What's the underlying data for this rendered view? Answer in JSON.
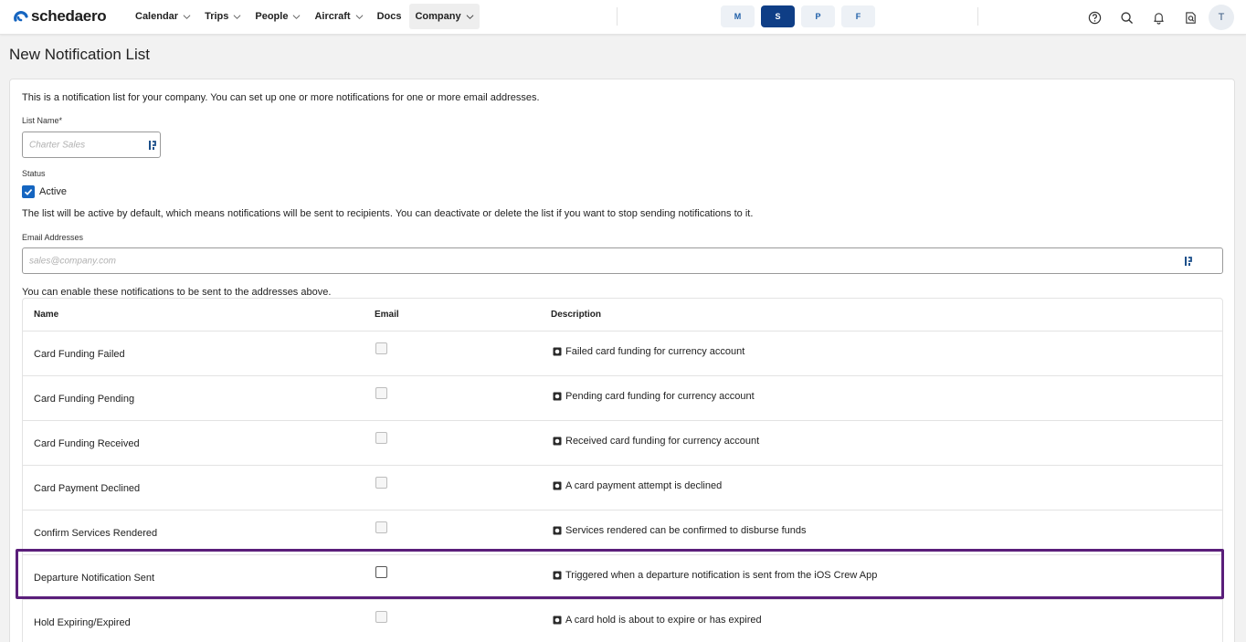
{
  "brand": {
    "name": "schedaero"
  },
  "nav": [
    {
      "label": "Calendar",
      "has_menu": true
    },
    {
      "label": "Trips",
      "has_menu": true
    },
    {
      "label": "People",
      "has_menu": true
    },
    {
      "label": "Aircraft",
      "has_menu": true
    },
    {
      "label": "Docs",
      "has_menu": false
    },
    {
      "label": "Company",
      "has_menu": true,
      "active": true
    }
  ],
  "modes": [
    {
      "label": "M",
      "selected": false
    },
    {
      "label": "S",
      "selected": true
    },
    {
      "label": "P",
      "selected": false
    },
    {
      "label": "F",
      "selected": false
    }
  ],
  "top_icons": [
    "help-icon",
    "search-icon",
    "bell-icon",
    "document-search-icon"
  ],
  "user": {
    "initial": "T"
  },
  "page": {
    "title": "New Notification List"
  },
  "form": {
    "intro": "This is a notification list for your company. You can set up one or more notifications for one or more email addresses.",
    "list_name_label": "List Name*",
    "list_name_placeholder": "Charter Sales",
    "status_label": "Status",
    "active_label": "Active",
    "active_checked": true,
    "status_note": "The list will be active by default, which means notifications will be sent to recipients. You can deactivate or delete the list if you want to stop sending notifications to it.",
    "email_label": "Email Addresses",
    "email_placeholder": "sales@company.com",
    "enable_note": "You can enable these notifications to be sent to the addresses above."
  },
  "table": {
    "columns": {
      "name": "Name",
      "email": "Email",
      "description": "Description"
    },
    "rows": [
      {
        "name": "Card Funding Failed",
        "email": false,
        "description": "Failed card funding for currency account"
      },
      {
        "name": "Card Funding Pending",
        "email": false,
        "description": "Pending card funding for currency account"
      },
      {
        "name": "Card Funding Received",
        "email": false,
        "description": "Received card funding for currency account"
      },
      {
        "name": "Card Payment Declined",
        "email": false,
        "description": "A card payment attempt is declined"
      },
      {
        "name": "Confirm Services Rendered",
        "email": false,
        "description": "Services rendered can be confirmed to disburse funds"
      },
      {
        "name": "Departure Notification Sent",
        "email": false,
        "description": "Triggered when a departure notification is sent from the iOS Crew App",
        "highlighted": true
      },
      {
        "name": "Hold Expiring/Expired",
        "email": false,
        "description": "A card hold is about to expire or has expired"
      }
    ]
  },
  "colors": {
    "brand_blue": "#1565c0",
    "mode_selected": "#0f3e86",
    "highlight_border": "#5a1e7a"
  }
}
